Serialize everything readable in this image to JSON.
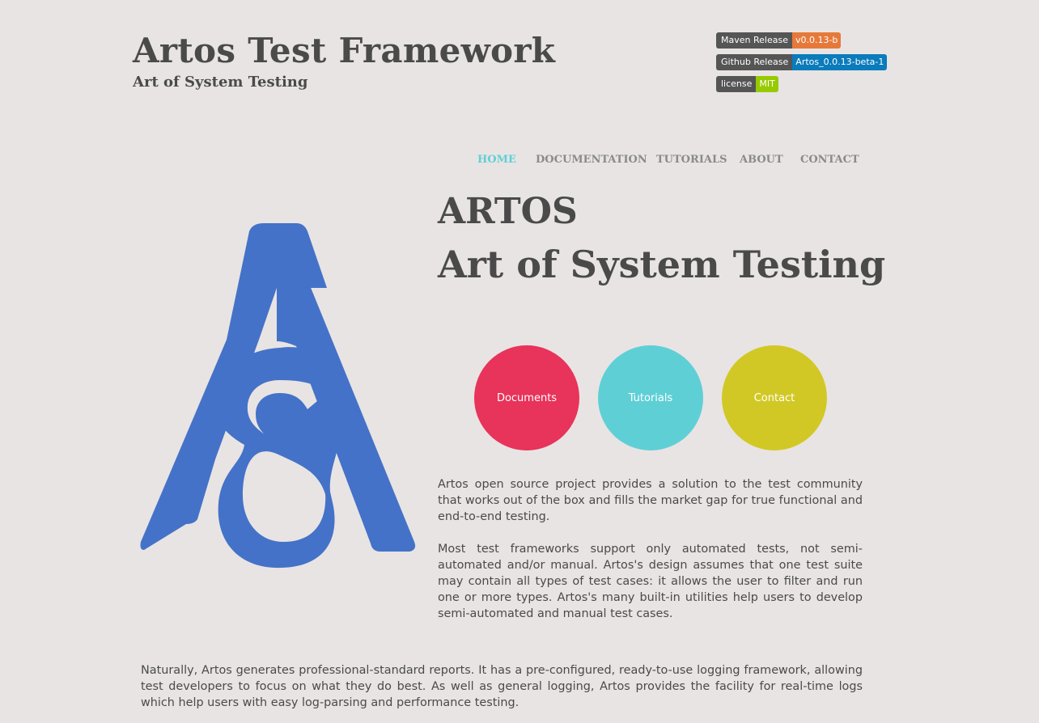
{
  "header": {
    "title": "Artos Test Framework",
    "tagline": "Art of System Testing"
  },
  "badges": [
    {
      "label": "Maven Release",
      "value": "v0.0.13-b",
      "color": "#e6793a"
    },
    {
      "label": "Github Release",
      "value": "Artos_0.0.13-beta-1",
      "color": "#0a7bbb"
    },
    {
      "label": "license",
      "value": "MIT",
      "color": "#97ca00"
    }
  ],
  "nav": {
    "items": [
      "HOME",
      "DOCUMENTATION",
      "TUTORIALS",
      "ABOUT",
      "CONTACT"
    ],
    "active": "HOME",
    "active_color": "#5fcfd6"
  },
  "hero": {
    "title": "ARTOS",
    "subtitle": "Art of System Testing"
  },
  "logo": {
    "icon": "artos-logo-icon",
    "color": "#4472c8"
  },
  "circles": [
    {
      "label": "Documents",
      "color": "#e8335a"
    },
    {
      "label": "Tutorials",
      "color": "#5fcfd6"
    },
    {
      "label": "Contact",
      "color": "#d2c825"
    }
  ],
  "content": {
    "p1": "Artos open source project provides a solution to the test community that works out of the box and fills the market gap for true functional and end-to-end testing.",
    "p2": "Most test frameworks support only automated tests, not semi-automated and/or manual. Artos's design assumes that one test suite may contain all types of test cases: it allows the user to filter and run one or more types. Artos's many built-in utilities help users to develop semi-automated and manual test cases.",
    "p3": "Naturally, Artos generates professional-standard reports. It has a pre-configured, ready-to-use logging framework, allowing test developers to focus on what they do best. As well as general logging, Artos provides the facility for real-time logs which help users with easy log-parsing and performance testing."
  }
}
